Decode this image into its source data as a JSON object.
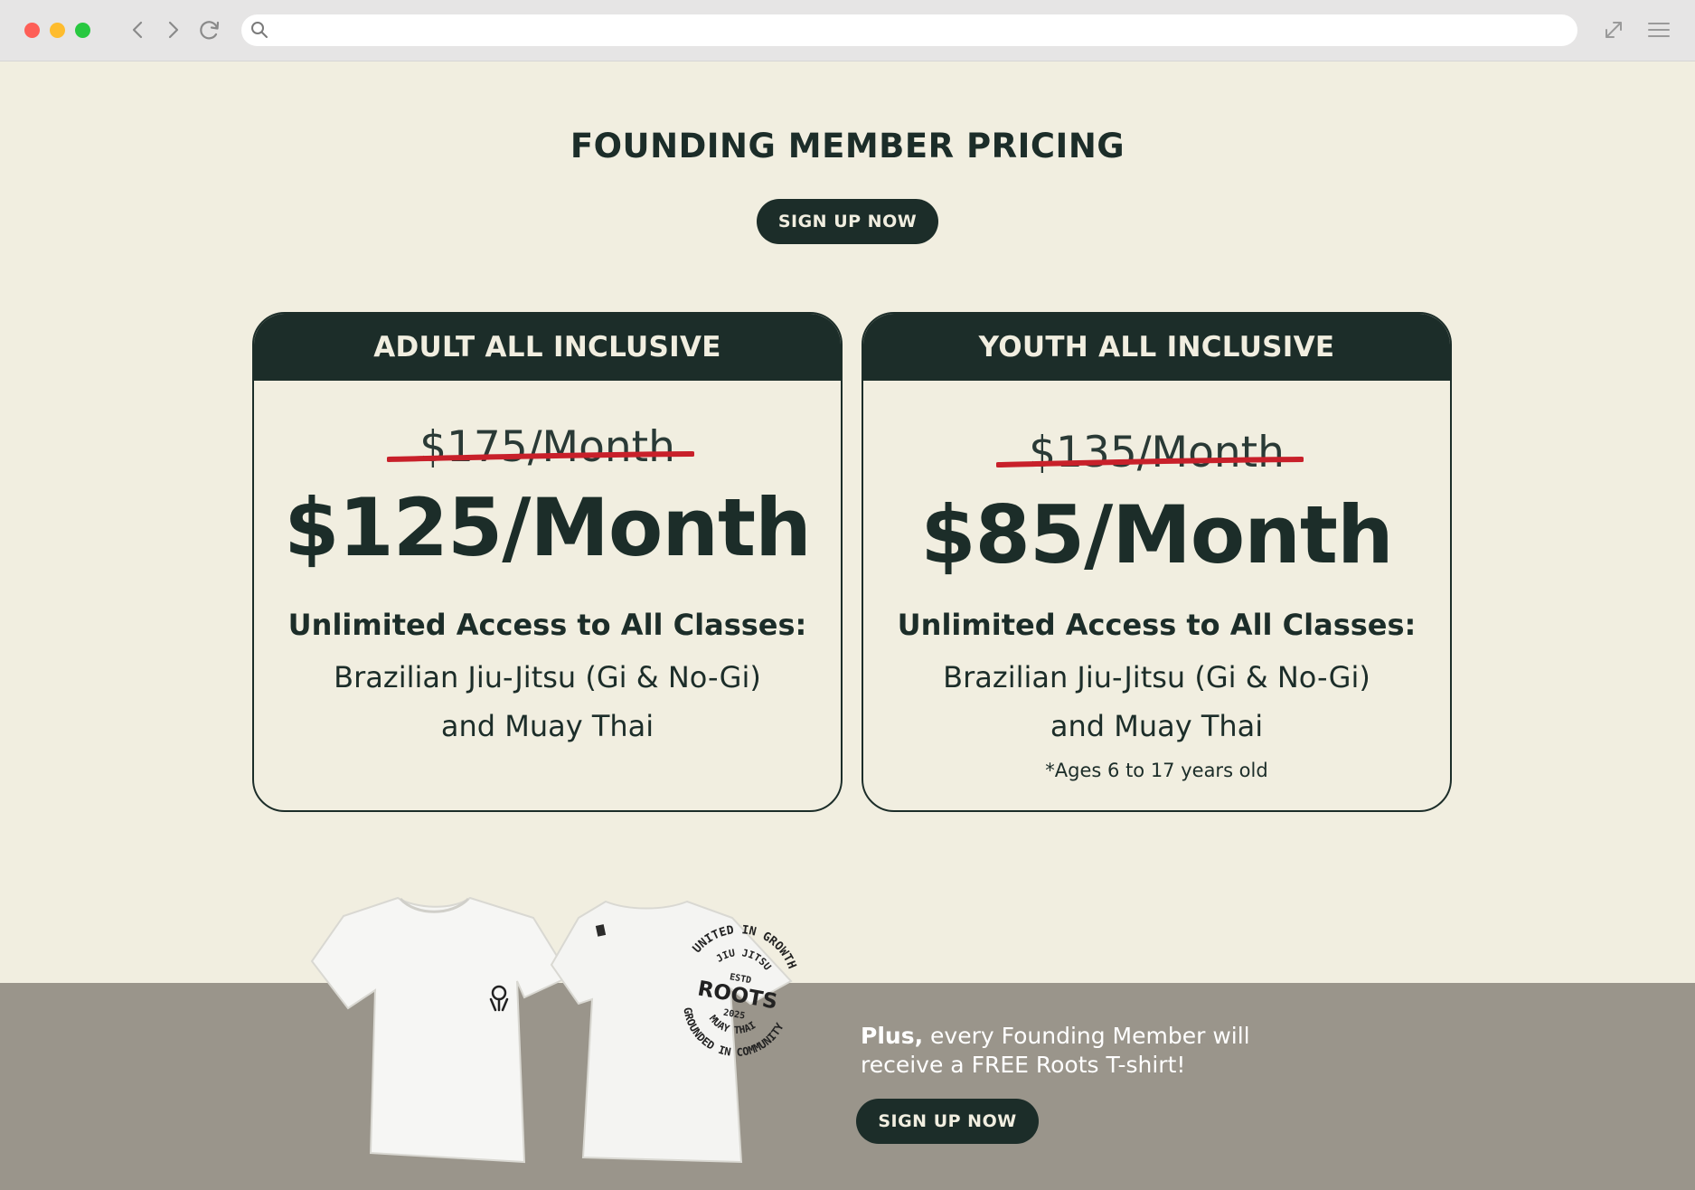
{
  "browser": {
    "icons": [
      "back-icon",
      "forward-icon",
      "reload-icon",
      "search-icon",
      "expand-icon",
      "menu-icon"
    ]
  },
  "page": {
    "title": "FOUNDING MEMBER PRICING",
    "signup_label": "SIGN UP NOW"
  },
  "cards": [
    {
      "header": "ADULT ALL INCLUSIVE",
      "old_price": "$175/Month",
      "new_price": "$125/Month",
      "access": "Unlimited Access to All Classes:",
      "desc_line1": "Brazilian Jiu-Jitsu (Gi & No-Gi)",
      "desc_line2": "and Muay Thai"
    },
    {
      "header": "YOUTH ALL INCLUSIVE",
      "old_price": "$135/Month",
      "new_price": "$85/Month",
      "access": "Unlimited Access to All Classes:",
      "desc_line1": "Brazilian Jiu-Jitsu (Gi & No-Gi)",
      "desc_line2": "and Muay Thai",
      "note": "*Ages 6 to 17 years old"
    }
  ],
  "promo": {
    "plus_bold": "Plus,",
    "plus_text": "every Founding Member will receive a FREE Roots T-shirt!",
    "signup_label": "SIGN UP NOW",
    "shirt_badge": {
      "top_arc": "UNITED IN GROWTH",
      "inner_arc": "JIU JITSU",
      "estd": "ESTD",
      "brand": "ROOTS",
      "year": "2025",
      "inner_bottom": "MUAY THAI",
      "bottom_arc": "GROUNDED IN COMMUNITY"
    }
  },
  "colors": {
    "page_bg": "#f1eee0",
    "dark_green": "#1c2d29",
    "strike_red": "#c8202a",
    "band_bg": "#9a958b"
  }
}
